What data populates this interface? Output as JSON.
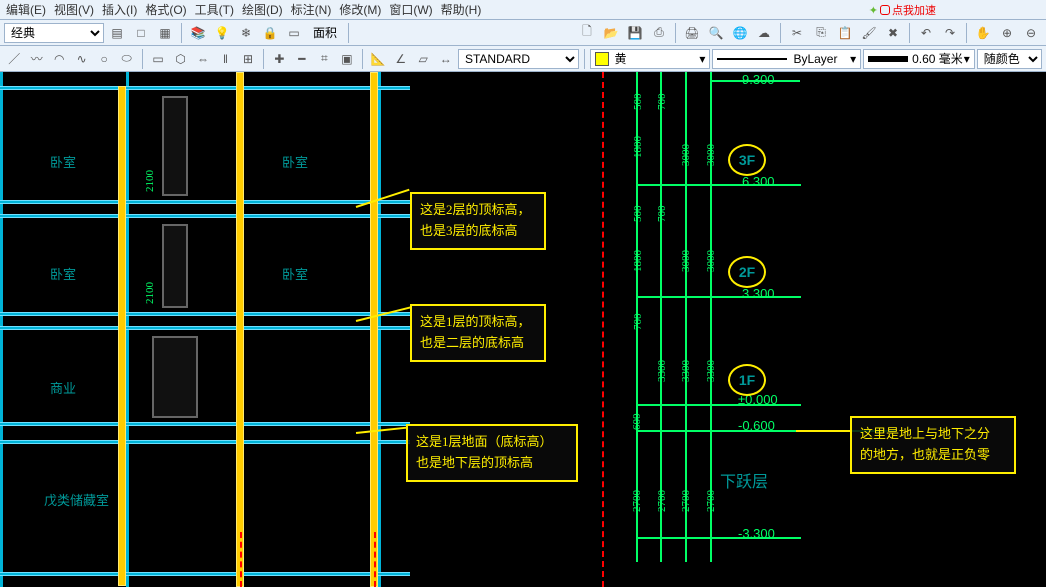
{
  "menus": [
    "编辑(E)",
    "视图(V)",
    "插入(I)",
    "格式(O)",
    "工具(T)",
    "绘图(D)",
    "标注(N)",
    "修改(M)",
    "窗口(W)",
    "帮助(H)"
  ],
  "accel_tip": "点我加速",
  "style_combo": "经典",
  "area_label": "面积",
  "textstyle": "STANDARD",
  "color": {
    "swatch": "#ffee00",
    "name": "黄"
  },
  "linetype": "ByLayer",
  "lineweight": "0.60 毫米",
  "color_mode": "随颜色",
  "rooms": {
    "bedroom": "卧室",
    "commercial": "商业",
    "storage": "戊类储藏室"
  },
  "dims": {
    "h_top": "9.300",
    "v1a": "500",
    "v1b": "700",
    "v2": "1800",
    "v3": "3000",
    "v4": "3000",
    "v5a": "500",
    "v5b": "700",
    "v6": "1800",
    "v7": "3000",
    "v8": "3000",
    "v9": "700",
    "v10": "3300",
    "v11": "3300",
    "v12": "3300",
    "v_low": "600",
    "v13": "2700",
    "v14": "2700",
    "v15": "2700",
    "v16": "2700",
    "h_bot": "-3.300",
    "zero": "±0.000",
    "neg600": "-0.600",
    "f2": "3.300",
    "f3": "6.300",
    "door_h": "2100"
  },
  "floors": {
    "f3": "3F",
    "f2": "2F",
    "f1": "1F"
  },
  "xlabel": "下跃层",
  "callouts": {
    "c1_l1": "这是2层的顶标高，",
    "c1_l2": "也是3层的底标高",
    "c2_l1": "这是1层的顶标高，",
    "c2_l2": "也是二层的底标高",
    "c3_l1": "这是1层地面（底标高）",
    "c3_l2": "也是地下层的顶标高",
    "c4_l1": "这里是地上与地下之分",
    "c4_l2": "的地方，也就是正负零"
  }
}
